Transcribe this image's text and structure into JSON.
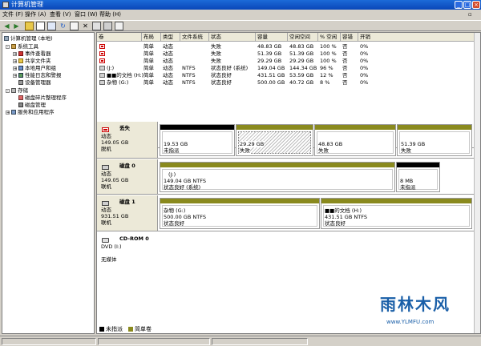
{
  "window": {
    "title": "计算机管理"
  },
  "menu": [
    "文件 (F)",
    "操作 (A)",
    "查看 (V)",
    "窗口 (W)",
    "帮助 (H)"
  ],
  "toolbar": {
    "icons": [
      "back-arrow-icon",
      "forward-arrow-icon",
      "up-folder-icon",
      "show-hide-tree-icon",
      "properties-icon",
      "refresh-icon",
      "export-icon",
      "delete-icon",
      "settings-icon",
      "disk-icon",
      "help-icon"
    ]
  },
  "tree": [
    {
      "label": "计算机管理 (本地)",
      "icon": "computer-icon",
      "level": 0
    },
    {
      "label": "系统工具",
      "icon": "tools-icon",
      "level": 1,
      "expander": "-"
    },
    {
      "label": "事件查看器",
      "icon": "event-viewer-icon",
      "level": 2,
      "expander": "+"
    },
    {
      "label": "共享文件夹",
      "icon": "shared-folder-icon",
      "level": 2,
      "expander": "+"
    },
    {
      "label": "本地用户和组",
      "icon": "users-icon",
      "level": 2,
      "expander": "+"
    },
    {
      "label": "性能日志和警报",
      "icon": "performance-icon",
      "level": 2,
      "expander": "+"
    },
    {
      "label": "设备管理器",
      "icon": "device-manager-icon",
      "level": 2
    },
    {
      "label": "存储",
      "icon": "storage-icon",
      "level": 1,
      "expander": "-"
    },
    {
      "label": "磁盘碎片整理程序",
      "icon": "defrag-icon",
      "level": 2
    },
    {
      "label": "磁盘管理",
      "icon": "disk-management-icon",
      "level": 2
    },
    {
      "label": "服务和应用程序",
      "icon": "services-icon",
      "level": 1,
      "expander": "+"
    }
  ],
  "volume_columns": [
    "卷",
    "布局",
    "类型",
    "文件系统",
    "状态",
    "容量",
    "空闲空间",
    "% 空闲",
    "容错",
    "开销"
  ],
  "volumes": [
    [
      "",
      "简单",
      "动态",
      "",
      "失败",
      "48.83 GB",
      "48.83 GB",
      "100 %",
      "否",
      "0%"
    ],
    [
      "",
      "简单",
      "动态",
      "",
      "失败",
      "51.39 GB",
      "51.39 GB",
      "100 %",
      "否",
      "0%"
    ],
    [
      "",
      "简单",
      "动态",
      "",
      "失败",
      "29.29 GB",
      "29.29 GB",
      "100 %",
      "否",
      "0%"
    ],
    [
      "(J:)",
      "简单",
      "动态",
      "NTFS",
      "状态良好 (系统)",
      "149.04 GB",
      "144.34 GB",
      "96 %",
      "否",
      "0%"
    ],
    [
      "■■的文档 (H:)",
      "简单",
      "动态",
      "NTFS",
      "状态良好",
      "431.51 GB",
      "53.59 GB",
      "12 %",
      "否",
      "0%"
    ],
    [
      "杂物 (G:)",
      "简单",
      "动态",
      "NTFS",
      "状态良好",
      "500.00 GB",
      "40.72 GB",
      "8 %",
      "否",
      "0%"
    ]
  ],
  "volume_icons": [
    "error-volume-icon",
    "error-volume-icon",
    "error-volume-icon",
    "volume-icon",
    "volume-icon",
    "volume-icon"
  ],
  "disks": [
    {
      "name": "丢失",
      "type": "动态",
      "size": "149.05 GB",
      "status": "脱机",
      "partitions": [
        {
          "size": "19.53 GB",
          "status": "未指派",
          "bar": "black"
        },
        {
          "size": "29.29 GB",
          "status": "失败",
          "bar": "olive",
          "hatched": true
        },
        {
          "size": "48.83 GB",
          "status": "失败",
          "bar": "olive"
        },
        {
          "size": "51.39 GB",
          "status": "失败",
          "bar": "olive"
        }
      ]
    },
    {
      "name": "磁盘 0",
      "type": "动态",
      "size": "149.05 GB",
      "status": "联机",
      "partitions": [
        {
          "label": "(J:)",
          "size": "149.04 GB NTFS",
          "status": "状态良好 (系统)",
          "bar": "olive"
        },
        {
          "size": "8 MB",
          "status": "未指派",
          "bar": "black"
        }
      ]
    },
    {
      "name": "磁盘 1",
      "type": "动态",
      "size": "931.51 GB",
      "status": "联机",
      "partitions": [
        {
          "label": "杂物 (G:)",
          "size": "500.00 GB NTFS",
          "status": "状态良好",
          "bar": "olive"
        },
        {
          "label": "■■的文档 (H:)",
          "size": "431.51 GB NTFS",
          "status": "状态良好",
          "bar": "olive"
        }
      ]
    },
    {
      "name": "CD-ROM 0",
      "type": "DVD (I:)",
      "size": "",
      "status": "无媒体",
      "partitions": []
    }
  ],
  "legend": [
    {
      "label": "未指派",
      "color": "#000000"
    },
    {
      "label": "简单卷",
      "color": "#8a8a1e"
    }
  ],
  "watermark": {
    "brand": "雨林木风",
    "url": "www.YLMFU.com"
  }
}
